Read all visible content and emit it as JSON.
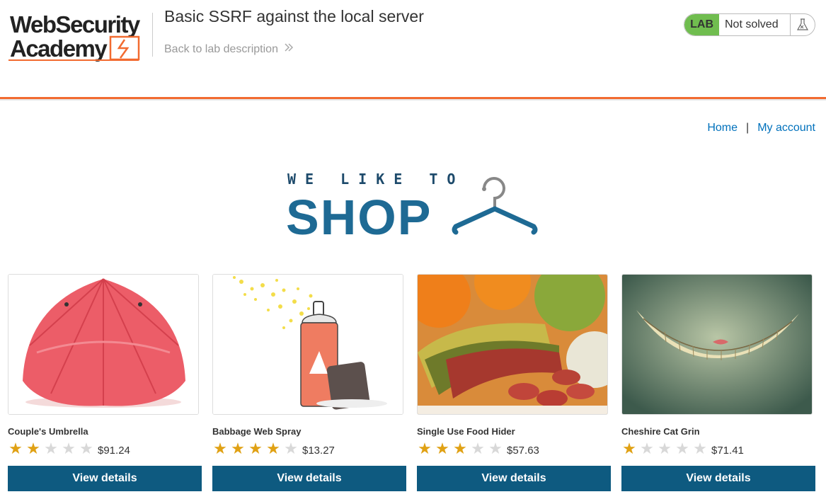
{
  "header": {
    "logo_line1": "WebSecurity",
    "logo_line2": "Academy",
    "lab_title": "Basic SSRF against the local server",
    "back_link": "Back to lab description",
    "status": {
      "badge": "LAB",
      "text": "Not solved",
      "icon": "flask-icon"
    }
  },
  "nav": {
    "home": "Home",
    "separator": "|",
    "account": "My account"
  },
  "banner": {
    "tagline": "WE LIKE TO",
    "word": "SHOP",
    "icon": "hanger-icon"
  },
  "colors": {
    "accent_orange": "#f26b30",
    "lab_green": "#70bd4f",
    "button_blue": "#0e5a80",
    "link_blue": "#0071bc",
    "star_gold": "#e0a114"
  },
  "products": [
    {
      "name": "Couple's Umbrella",
      "rating": 2,
      "rating_max": 5,
      "price": "$91.24",
      "button": "View details",
      "image": "red-umbrella-image"
    },
    {
      "name": "Babbage Web Spray",
      "rating": 4,
      "rating_max": 5,
      "price": "$13.27",
      "button": "View details",
      "image": "spray-can-image"
    },
    {
      "name": "Single Use Food Hider",
      "rating": 3,
      "rating_max": 5,
      "price": "$57.63",
      "button": "View details",
      "image": "banana-salami-image"
    },
    {
      "name": "Cheshire Cat Grin",
      "rating": 1,
      "rating_max": 5,
      "price": "$71.41",
      "button": "View details",
      "image": "cat-grin-image"
    }
  ]
}
